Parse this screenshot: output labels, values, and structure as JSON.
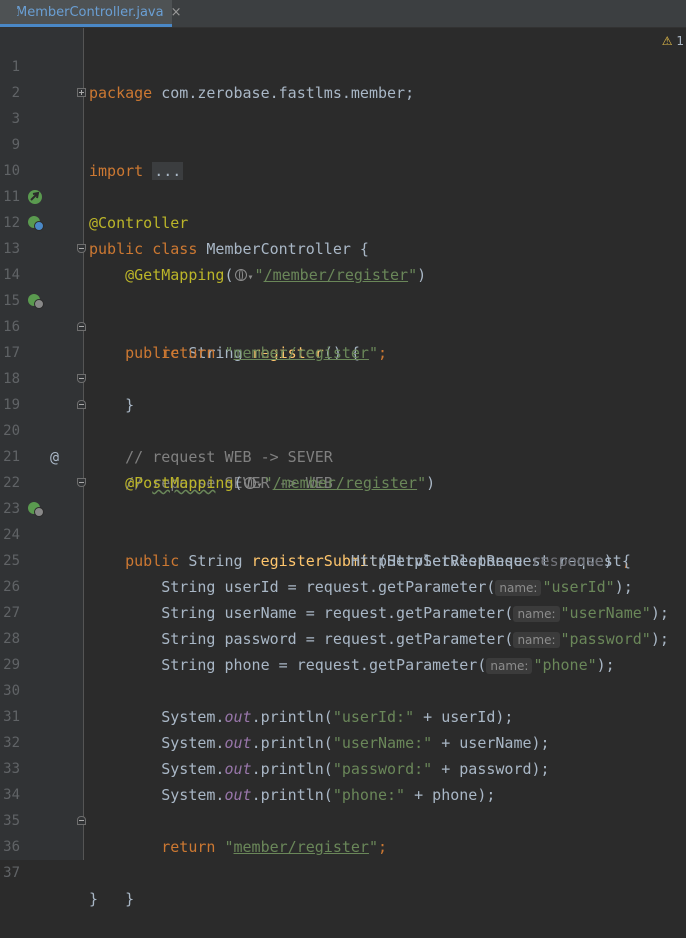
{
  "tab": {
    "filename": "MemberController.java",
    "close": "×"
  },
  "warning": {
    "icon": "⚠",
    "count": "1"
  },
  "line_numbers": [
    "1",
    "2",
    "3",
    "9",
    "10",
    "11",
    "12",
    "13",
    "14",
    "15",
    "16",
    "17",
    "18",
    "19",
    "20",
    "21",
    "22",
    "23",
    "24",
    "25",
    "26",
    "27",
    "28",
    "29",
    "30",
    "31",
    "32",
    "33",
    "34",
    "35",
    "36",
    "37"
  ],
  "code": {
    "l1": {
      "kw": "package",
      "rest": " com.zerobase.fastlms.member;"
    },
    "l3": {
      "kw": "import",
      "dots": "..."
    },
    "l10": {
      "ann": "@Controller"
    },
    "l11": {
      "kw1": "public",
      "kw2": "class",
      "name": " MemberController {"
    },
    "l13": {
      "ann": "@GetMapping",
      "open": "(",
      "q1": "\"",
      "url": "/member/register",
      "q2": "\"",
      "close": ")"
    },
    "l14": {
      "kw": "public",
      "type": " String ",
      "fn": "register",
      "rest": "() {"
    },
    "l16": {
      "kw": "return",
      "q1": "\"",
      "str": "member/register",
      "q2": "\"",
      "end": ";"
    },
    "l17": {
      "brace": "}"
    },
    "l19": {
      "comment": "// request WEB -> SEVER"
    },
    "l20": {
      "c1": "// ",
      "typo": "reponse",
      "c2": " SEVER -> WEB"
    },
    "l21": {
      "ann": "@PostMapping",
      "open": "(",
      "q1": "\"",
      "url": "/member/register",
      "q2": "\"",
      "close": ")"
    },
    "l22": {
      "kw": "public",
      "type": " String ",
      "fn": "registerSubmit",
      "rest": "(HttpServletRequest request",
      "comma": ","
    },
    "l23": {
      "type": "HttpServletResponse ",
      "unused": "response",
      "rest": ") {"
    },
    "l25": {
      "pre": "String userId = request.getParameter(",
      "hint": "name:",
      "str": "\"userId\"",
      "end": ");"
    },
    "l26": {
      "pre": "String userName = request.getParameter(",
      "hint": "name:",
      "str": "\"userName\"",
      "end": ");"
    },
    "l27": {
      "pre": "String password = request.getParameter(",
      "hint": "name:",
      "str": "\"password\"",
      "end": ");"
    },
    "l28": {
      "pre": "String phone = request.getParameter(",
      "hint": "name:",
      "str": "\"phone\"",
      "end": ");"
    },
    "l30": {
      "sys": "System.",
      "out": "out",
      "pr": ".println(",
      "str": "\"userId:\"",
      "rest": " + userId);"
    },
    "l31": {
      "sys": "System.",
      "out": "out",
      "pr": ".println(",
      "str": "\"userName:\"",
      "rest": " + userName);"
    },
    "l32": {
      "sys": "System.",
      "out": "out",
      "pr": ".println(",
      "str": "\"password:\"",
      "rest": " + password);"
    },
    "l33": {
      "sys": "System.",
      "out": "out",
      "pr": ".println(",
      "str": "\"phone:\"",
      "rest": " + phone);"
    },
    "l35": {
      "kw": "return",
      "q1": "\"",
      "str": "member/register",
      "q2": "\"",
      "end": ";"
    },
    "l36": {
      "brace": "}"
    },
    "l37": {
      "brace": "}"
    }
  },
  "gutter_icons": {
    "spring_bean": "spring-bean-icon",
    "request_mapping": "request-mapping-icon",
    "at_symbol": "@"
  },
  "colors": {
    "keyword": "#cc7832",
    "annotation": "#bbb529",
    "string": "#6a8759",
    "comment": "#808080",
    "function": "#ffc66d",
    "static_field": "#9876aa",
    "text": "#a9b7c6",
    "background": "#2b2b2b"
  }
}
